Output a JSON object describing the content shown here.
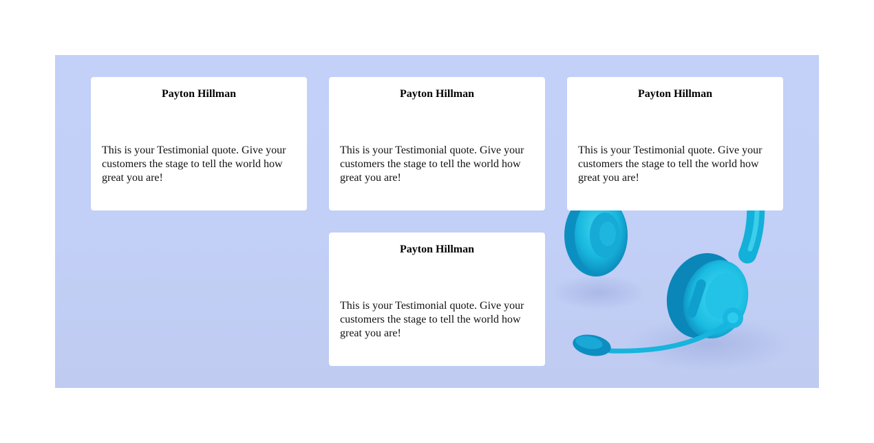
{
  "colors": {
    "background": "#ffffff",
    "section_background": "#c3d0f8",
    "card_background": "#ffffff",
    "headset_primary": "#1cc6e6",
    "headset_shadow": "#0a92c4"
  },
  "section": {
    "image": "headset-illustration",
    "testimonials": [
      {
        "name": "Payton Hillman",
        "quote": "This is your Testimonial quote. Give your customers the stage to tell the world how great you are!"
      },
      {
        "name": "Payton Hillman",
        "quote": "This is your Testimonial quote. Give your customers the stage to tell the world how great you are!"
      },
      {
        "name": "Payton Hillman",
        "quote": "This is your Testimonial quote. Give your customers the stage to tell the world how great you are!"
      },
      {
        "name": "Payton Hillman",
        "quote": "This is your Testimonial quote. Give your customers the stage to tell the world how great you are!"
      }
    ]
  }
}
